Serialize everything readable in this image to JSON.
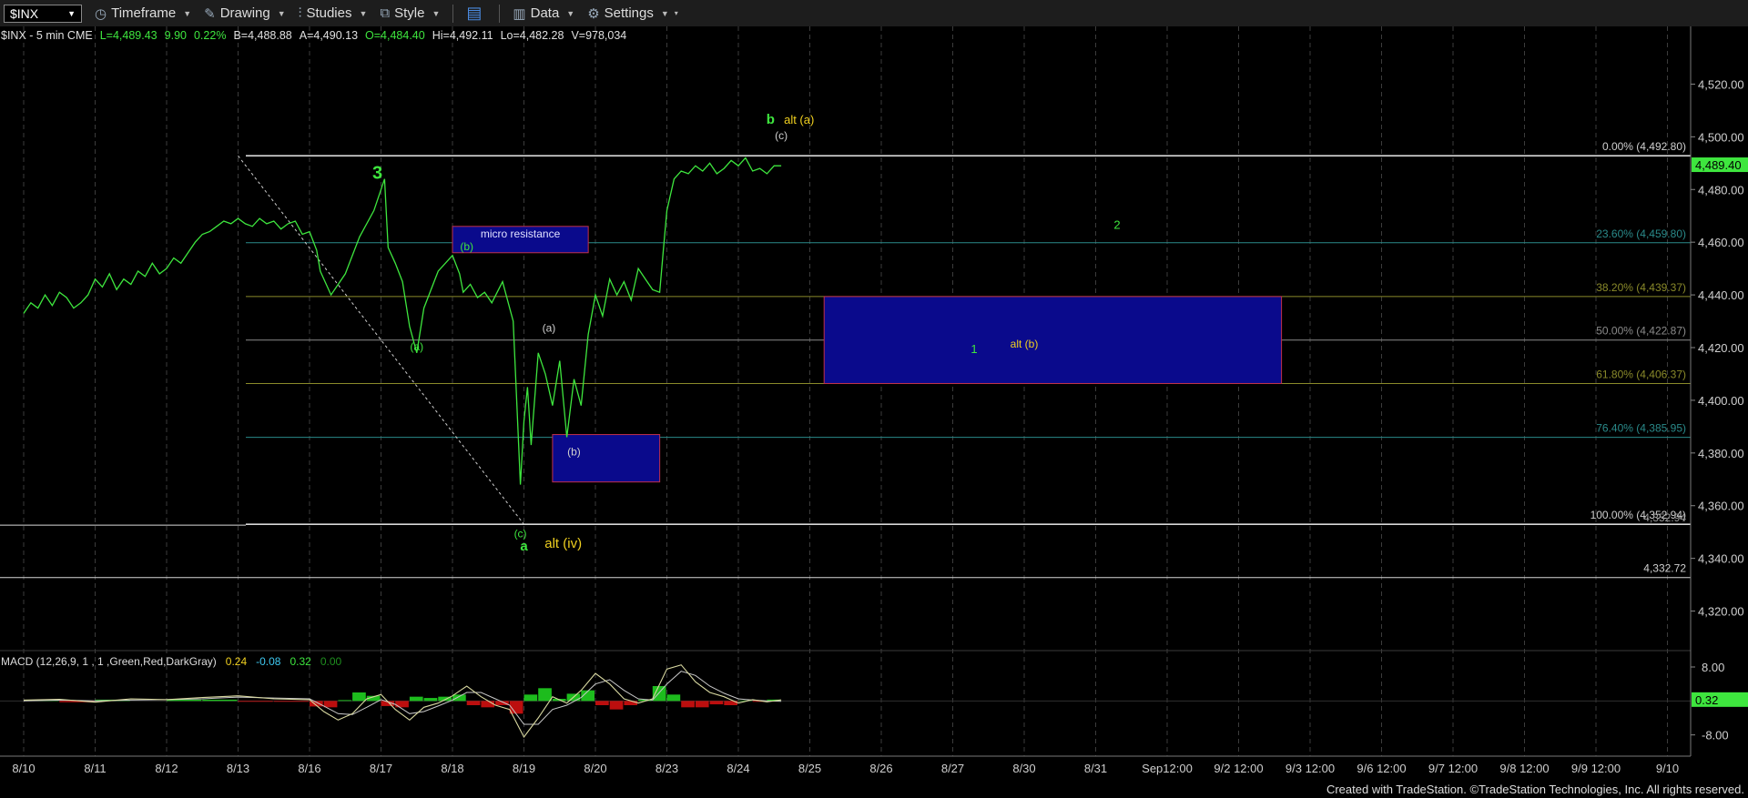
{
  "toolbar": {
    "symbol": "$INX",
    "timeframe": "Timeframe",
    "drawing": "Drawing",
    "studies": "Studies",
    "style": "Style",
    "data": "Data",
    "settings": "Settings"
  },
  "header_items": [
    {
      "text": "$INX - 5 min  CME",
      "color": "#e0e0e0"
    },
    {
      "text": "L=4,489.43",
      "color": "#3ee63e"
    },
    {
      "text": "9.90",
      "color": "#3ee63e"
    },
    {
      "text": "0.22%",
      "color": "#3ee63e"
    },
    {
      "text": "B=4,488.88",
      "color": "#e0e0e0"
    },
    {
      "text": "A=4,490.13",
      "color": "#e0e0e0"
    },
    {
      "text": "O=4,484.40",
      "color": "#3ee63e"
    },
    {
      "text": "Hi=4,492.11",
      "color": "#e0e0e0"
    },
    {
      "text": "Lo=4,482.28",
      "color": "#e0e0e0"
    },
    {
      "text": "V=978,034",
      "color": "#e0e0e0"
    }
  ],
  "footer": "Created with TradeStation. ©TradeStation Technologies, Inc. All rights reserved.",
  "colors": {
    "price": "#3ee63e",
    "box_fill": "#0a0a8c",
    "box_border": "#c0304a",
    "macd_line": "#d8d8a0",
    "signal_line": "#c8c8c8",
    "hist_pos": "#22dd22",
    "hist_neg": "#dd1111"
  },
  "chart_data": {
    "type": "line",
    "symbol": "$INX",
    "interval": "5 min",
    "x_labels": [
      "8/10",
      "8/11",
      "8/12",
      "8/13",
      "8/16",
      "8/17",
      "8/18",
      "8/19",
      "8/20",
      "8/23",
      "8/24",
      "8/25",
      "8/26",
      "8/27",
      "8/30",
      "8/31",
      "Sep12:00",
      "9/2 12:00",
      "9/3 12:00",
      "9/6 12:00",
      "9/7 12:00",
      "9/8 12:00",
      "9/9 12:00",
      "9/10"
    ],
    "ylim": [
      4305,
      4535
    ],
    "y_ticks": [
      "4,520.00",
      "4,500.00",
      "4,480.00",
      "4,460.00",
      "4,440.00",
      "4,420.00",
      "4,400.00",
      "4,380.00",
      "4,360.00",
      "4,340.00",
      "4,320.00"
    ],
    "y_tick_values": [
      4520,
      4500,
      4480,
      4460,
      4440,
      4420,
      4400,
      4380,
      4360,
      4340,
      4320
    ],
    "last_price_label": "4,489.40",
    "last_price": 4489.4,
    "series": [
      {
        "x": [
          0,
          0.1,
          0.2,
          0.3,
          0.4,
          0.5,
          0.6,
          0.7,
          0.8,
          0.9,
          1,
          1.1,
          1.2,
          1.3,
          1.4,
          1.5,
          1.6,
          1.7,
          1.8,
          1.9,
          2,
          2.1,
          2.2,
          2.3,
          2.4,
          2.5,
          2.6,
          2.7,
          2.8,
          2.9,
          3,
          3.1,
          3.2,
          3.3,
          3.4,
          3.5,
          3.6,
          3.7,
          3.8,
          3.9,
          4,
          4.1,
          4.15,
          4.3,
          4.5,
          4.7,
          4.9,
          5.05,
          5.1,
          5.2,
          5.3,
          5.4,
          5.5,
          5.6,
          5.8,
          6,
          6.1,
          6.15,
          6.25,
          6.35,
          6.45,
          6.55,
          6.7,
          6.85,
          6.95,
          7,
          7.05,
          7.1,
          7.2,
          7.3,
          7.4,
          7.5,
          7.6,
          7.7,
          7.8,
          7.9,
          8,
          8.1,
          8.2,
          8.3,
          8.4,
          8.5,
          8.6,
          8.7,
          8.8,
          8.9,
          8.95,
          9,
          9.1,
          9.2,
          9.3,
          9.4,
          9.5,
          9.6,
          9.7,
          9.8,
          9.9,
          10,
          10.1,
          10.2,
          10.3,
          10.4,
          10.5,
          10.6
        ],
        "y": [
          4433,
          4437,
          4435,
          4440,
          4436,
          4441,
          4439,
          4435,
          4437,
          4440,
          4446,
          4443,
          4448,
          4442,
          4446,
          4444,
          4449,
          4447,
          4452,
          4448,
          4450,
          4454,
          4452,
          4456,
          4460,
          4463,
          4464,
          4466,
          4468,
          4467,
          4469,
          4467,
          4466,
          4469,
          4467,
          4468,
          4465,
          4467,
          4468,
          4463,
          4464,
          4457,
          4449,
          4440,
          4448,
          4462,
          4472,
          4484,
          4458,
          4452,
          4445,
          4428,
          4418,
          4435,
          4449,
          4455,
          4448,
          4441,
          4444,
          4439,
          4441,
          4437,
          4445,
          4430,
          4368,
          4392,
          4405,
          4383,
          4418,
          4410,
          4398,
          4415,
          4386,
          4408,
          4398,
          4425,
          4440,
          4432,
          4446,
          4440,
          4445,
          4438,
          4450,
          4446,
          4442,
          4441,
          4457,
          4472,
          4484,
          4487,
          4486,
          4489,
          4487,
          4490,
          4486,
          4488,
          4491,
          4489,
          4492,
          4487,
          4488,
          4486,
          4489,
          4489
        ]
      }
    ],
    "fib_levels": [
      {
        "label": "0.00% (4,492.80)",
        "value": 4492.8,
        "color": "#d8d8d8"
      },
      {
        "label": "23.60% (4,459.80)",
        "value": 4459.8,
        "color": "#2a8a8a"
      },
      {
        "label": "38.20% (4,439.37)",
        "value": 4439.37,
        "color": "#8a8a2a"
      },
      {
        "label": "50.00% (4,422.87)",
        "value": 4422.87,
        "color": "#8a8a8a"
      },
      {
        "label": "61.80% (4,406.37)",
        "value": 4406.37,
        "color": "#8a8a2a"
      },
      {
        "label": "76.40% (4,385.95)",
        "value": 4385.95,
        "color": "#2a8a8a"
      },
      {
        "label": "100.00% (4,352.94)",
        "value": 4352.94,
        "color": "#d8d8d8"
      }
    ],
    "fib_overlap_label": "4,352.94",
    "support_line": {
      "label": "4,332.72",
      "value": 4332.72
    },
    "trendline": {
      "x": [
        3,
        7
      ],
      "y": [
        4492.8,
        4352.94
      ]
    },
    "boxes": [
      {
        "name": "micro-resistance-box",
        "label": "micro resistance",
        "x": [
          6.0,
          7.9
        ],
        "y": [
          4456,
          4466
        ]
      },
      {
        "name": "wave-b-support-box",
        "label": "",
        "x": [
          7.4,
          8.9
        ],
        "y": [
          4369,
          4387
        ]
      },
      {
        "name": "target-box-wave-1",
        "label": "",
        "x": [
          11.2,
          17.6
        ],
        "y": [
          4406.37,
          4439.37
        ]
      }
    ],
    "annotations": [
      {
        "text": "3",
        "x": 4.95,
        "y": 4484,
        "color": "#3ee63e",
        "size": 20,
        "bold": true
      },
      {
        "text": "(b)",
        "x": 6.2,
        "y": 4457,
        "color": "#3ee63e",
        "size": 12
      },
      {
        "text": "(a)",
        "x": 5.5,
        "y": 4419,
        "color": "#3ee63e",
        "size": 12
      },
      {
        "text": "(a)",
        "x": 7.35,
        "y": 4426,
        "color": "#cfcfcf",
        "size": 12
      },
      {
        "text": "(b)",
        "x": 7.7,
        "y": 4379,
        "color": "#cfcfcf",
        "size": 12
      },
      {
        "text": "(c)",
        "x": 6.95,
        "y": 4348,
        "color": "#3ee63e",
        "size": 12
      },
      {
        "text": "a",
        "x": 7.0,
        "y": 4343,
        "color": "#3ee63e",
        "size": 15,
        "bold": true
      },
      {
        "text": "alt (iv)",
        "x": 7.55,
        "y": 4344,
        "color": "#f0d020",
        "size": 15
      },
      {
        "text": "b",
        "x": 10.45,
        "y": 4505,
        "color": "#3ee63e",
        "size": 15,
        "bold": true
      },
      {
        "text": "alt (a)",
        "x": 10.85,
        "y": 4505,
        "color": "#f0d020",
        "size": 13
      },
      {
        "text": "(c)",
        "x": 10.6,
        "y": 4499,
        "color": "#cfcfcf",
        "size": 12
      },
      {
        "text": "2",
        "x": 15.3,
        "y": 4465,
        "color": "#3ee63e",
        "size": 13
      },
      {
        "text": "1",
        "x": 13.3,
        "y": 4418,
        "color": "#3ee63e",
        "size": 13
      },
      {
        "text": "alt (b)",
        "x": 14.0,
        "y": 4420,
        "color": "#f0d020",
        "size": 12
      }
    ],
    "macd": {
      "label": "MACD (12,26,9, 1 , 1 ,Green,Red,DarkGray)",
      "values_display": [
        {
          "text": "0.24",
          "color": "#f0d020"
        },
        {
          "text": "-0.08",
          "color": "#3ec8f0"
        },
        {
          "text": "0.32",
          "color": "#3ee63e"
        },
        {
          "text": "0.00",
          "color": "#1f8f1f"
        }
      ],
      "last_value_label": "0.32",
      "last_value": 0.32,
      "ylim": [
        -13,
        11
      ],
      "y_ticks": [
        "8.00",
        "-8.00"
      ],
      "y_tick_values": [
        8,
        -8
      ],
      "x": [
        0,
        0.5,
        1,
        1.5,
        2,
        2.5,
        3,
        3.5,
        4,
        4.2,
        4.4,
        4.6,
        4.8,
        5,
        5.2,
        5.4,
        5.6,
        5.8,
        6,
        6.2,
        6.4,
        6.6,
        6.8,
        7,
        7.2,
        7.4,
        7.6,
        7.8,
        8,
        8.2,
        8.4,
        8.6,
        8.8,
        9,
        9.2,
        9.4,
        9.6,
        9.8,
        10,
        10.2,
        10.4,
        10.6
      ],
      "macd": [
        0.2,
        0.4,
        -0.3,
        0.5,
        0.3,
        0.8,
        1.2,
        0.5,
        0.3,
        -2.5,
        -4.5,
        -3.0,
        0.5,
        1.5,
        -2.0,
        -4.5,
        -1.5,
        -0.5,
        1.2,
        3.5,
        1.0,
        -1.0,
        -2.0,
        -8.5,
        -4.0,
        1.0,
        -0.5,
        2.5,
        6.5,
        4.0,
        0.5,
        -0.5,
        0.5,
        7.5,
        8.5,
        4.5,
        2.0,
        1.0,
        -0.5,
        0.3,
        -0.2,
        0.24
      ],
      "signal": [
        0.0,
        0.2,
        0.0,
        0.2,
        0.3,
        0.5,
        0.9,
        0.7,
        0.5,
        -1.2,
        -3.0,
        -3.2,
        -1.5,
        0.3,
        -0.8,
        -3.0,
        -2.5,
        -1.2,
        0.2,
        2.0,
        2.0,
        0.5,
        -1.0,
        -5.5,
        -5.5,
        -2.0,
        -1.0,
        0.8,
        4.0,
        5.0,
        2.5,
        0.5,
        0.2,
        4.0,
        7.0,
        6.0,
        3.5,
        1.8,
        0.5,
        0.2,
        0.0,
        -0.08
      ]
    }
  }
}
